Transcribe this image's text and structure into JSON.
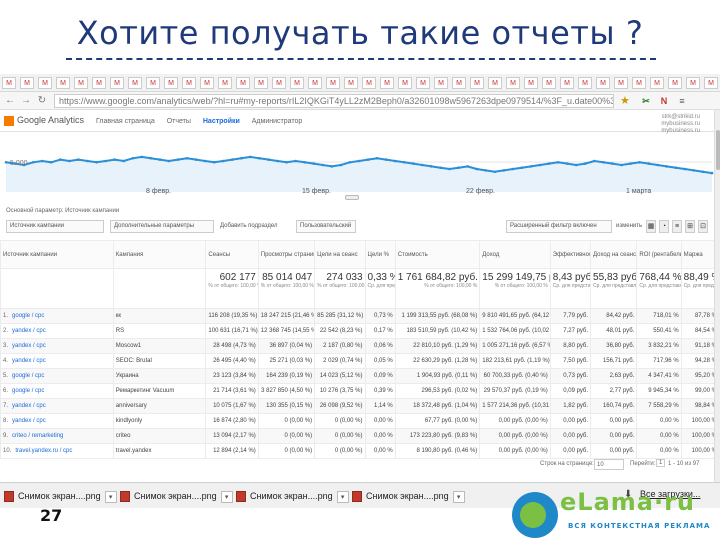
{
  "slide": {
    "title": "Хотите получать такие отчеты ?",
    "page_number": "27"
  },
  "browser": {
    "url": "https://www.google.com/analytics/web/?hl=ru#my-reports/rIL2IQKGiT4yLL2zM2Beph0/a32601098w5967263dpe0979514/%3F_u.date00%3D20130301%26_u.date01%3D20130331/",
    "tab_icons": [
      "M",
      "M",
      "M",
      "M",
      "M",
      "M",
      "M",
      "M",
      "M",
      "M",
      "M",
      "M",
      "M",
      "M",
      "M",
      "M",
      "M",
      "M",
      "M",
      "M",
      "M",
      "M",
      "M",
      "M",
      "M",
      "M",
      "M",
      "M",
      "M",
      "M",
      "M",
      "M",
      "M",
      "M",
      "M",
      "M",
      "M",
      "M",
      "M",
      "M",
      "M",
      "M",
      "M",
      "M",
      "M"
    ],
    "ext_icons": [
      "N",
      "✂",
      "≡"
    ]
  },
  "ga": {
    "logo_text": "Google Analytics",
    "nav": [
      "Главная страница",
      "Отчеты",
      "Настройки",
      "Администратор"
    ],
    "nav_active_index": 2,
    "user_line1": "strk@strikid.ru",
    "user_line2": "mybusiness.ru",
    "user_line3": "mybusiness.ru"
  },
  "chart_data": {
    "type": "line",
    "y_label_visible": "5 000",
    "x_ticks": [
      "8 февр.",
      "15 февр.",
      "22 февр.",
      "1 марта"
    ],
    "values": [
      62,
      61,
      60,
      62,
      63,
      62,
      64,
      63,
      64,
      63,
      62,
      63,
      64,
      63,
      65,
      66,
      65,
      64,
      63,
      64,
      65,
      64,
      63,
      62,
      63,
      64,
      65,
      66,
      65,
      64,
      63,
      62,
      63,
      62,
      61,
      60,
      59,
      60,
      62,
      63,
      64,
      65,
      64,
      63,
      62,
      61,
      60,
      59,
      58,
      57,
      58,
      59,
      57,
      56,
      55,
      56,
      57,
      58,
      59,
      60,
      61,
      62,
      61,
      60,
      61,
      63,
      62,
      61,
      60,
      61,
      62,
      61,
      60,
      59,
      58,
      57,
      56,
      55,
      54
    ]
  },
  "report": {
    "subheader": "Основной параметр: Источник кампании",
    "controls": {
      "select1": "Источник кампании",
      "select2": "Дополнительные параметры",
      "btn_add": "Добавить подраздел",
      "select3": "Пользовательский",
      "filter_placeholder": "Расширенный фильтр включен",
      "filter_btn": "изменить"
    },
    "view_icons": [
      "▦",
      "◔",
      "≡",
      "⊞",
      "⊡"
    ],
    "columns": [
      "Источник кампании",
      "Кампания",
      "Сеансы",
      "Просмотры страниц",
      "Цели на сеанс",
      "Цели %",
      "Стоимость",
      "Доход",
      "Эффективность",
      "Доход на сеанс",
      "ROI (рентабельность)",
      "Маржа"
    ],
    "totals": [
      {
        "big": "",
        "sub": ""
      },
      {
        "big": "",
        "sub": ""
      },
      {
        "big": "602 177",
        "sub": "% от общего: 100,00 % (602 177)"
      },
      {
        "big": "85 014 047",
        "sub": "% от общего: 100,00 % (85 014 047)"
      },
      {
        "big": "274 033",
        "sub": "% от общего: 100,00 % (274 033)"
      },
      {
        "big": "0,33 %",
        "sub": "Ср. для представления: 0,33 %"
      },
      {
        "big": "1 761 684,82 руб.",
        "sub": "% от общего: 100,00 %"
      },
      {
        "big": "15 299 149,75 руб.",
        "sub": "% от общего: 100,00 %"
      },
      {
        "big": "8,43 руб.",
        "sub": "Ср. для представления"
      },
      {
        "big": "55,83 руб.",
        "sub": "Ср. для представления"
      },
      {
        "big": "768,44 %",
        "sub": "Ср. для представления"
      },
      {
        "big": "88,49 %",
        "sub": "Ср. для представления"
      }
    ],
    "rows": [
      [
        "1.",
        "google / cpc",
        "кк",
        "116 208 (19,35 %)",
        "18 247 215 (21,46 %)",
        "85 285 (31,12 %)",
        "0,73 %",
        "1 199 313,55 руб. (68,08 %)",
        "9 810 491,65 руб. (64,12 %)",
        "7,79 руб.",
        "84,42 руб.",
        "718,01 %",
        "87,78 %"
      ],
      [
        "2.",
        "yandex / cpc",
        "RS",
        "100 631 (16,71 %)",
        "12 368 745 (14,55 %)",
        "22 542 (8,23 %)",
        "0,17 %",
        "183 510,59 руб. (10,42 %)",
        "1 532 764,06 руб. (10,02 %)",
        "7,27 руб.",
        "48,01 руб.",
        "550,41 %",
        "84,54 %"
      ],
      [
        "3.",
        "yandex / cpc",
        "Moscow1",
        "28 498 (4,73 %)",
        "36 897 (0,04 %)",
        "2 187 (0,80 %)",
        "0,06 %",
        "22 810,10 руб. (1,29 %)",
        "1 005 271,16 руб. (6,57 %)",
        "8,80 руб.",
        "36,80 руб.",
        "3 832,21 %",
        "91,18 %"
      ],
      [
        "4.",
        "yandex / cpc",
        "SEOC: Brutal",
        "26 495 (4,40 %)",
        "25 271 (0,03 %)",
        "2 029 (0,74 %)",
        "0,05 %",
        "22 630,29 руб. (1,28 %)",
        "182 213,61 руб. (1,19 %)",
        "7,50 руб.",
        "156,71 руб.",
        "717,96 %",
        "94,28 %"
      ],
      [
        "5.",
        "google / cpc",
        "Украина",
        "23 123 (3,84 %)",
        "164 239 (0,19 %)",
        "14 023 (5,12 %)",
        "0,09 %",
        "1 904,93 руб. (0,11 %)",
        "60 700,33 руб. (0,40 %)",
        "0,73 руб.",
        "2,63 руб.",
        "4 347,41 %",
        "95,20 %"
      ],
      [
        "6.",
        "google / cpc",
        "Ремаркетинг Vacuum",
        "21 714 (3,61 %)",
        "3 827 850 (4,50 %)",
        "10 276 (3,75 %)",
        "0,39 %",
        "296,53 руб. (0,02 %)",
        "29 570,37 руб. (0,19 %)",
        "0,09 руб.",
        "2,77 руб.",
        "9 945,34 %",
        "99,00 %"
      ],
      [
        "7.",
        "yandex / cpc",
        "anniversary",
        "10 075 (1,67 %)",
        "130 355 (0,15 %)",
        "26 098 (9,52 %)",
        "1,14 %",
        "18 372,48 руб. (1,04 %)",
        "1 577 214,36 руб. (10,31 %)",
        "1,82 руб.",
        "160,74 руб.",
        "7 558,29 %",
        "98,84 %"
      ],
      [
        "8.",
        "yandex / cpc",
        "kindlyonly",
        "16 874 (2,80 %)",
        "0 (0,00 %)",
        "0 (0,00 %)",
        "0,00 %",
        "67,77 руб. (0,00 %)",
        "0,00 руб. (0,00 %)",
        "0,00 руб.",
        "0,00 руб.",
        "0,00 %",
        "100,00 %"
      ],
      [
        "9.",
        "criteo / remarketing",
        "criteo",
        "13 094 (2,17 %)",
        "0 (0,00 %)",
        "0 (0,00 %)",
        "0,00 %",
        "173 223,80 руб. (9,83 %)",
        "0,00 руб. (0,00 %)",
        "0,00 руб.",
        "0,00 руб.",
        "0,00 %",
        "100,00 %"
      ],
      [
        "10.",
        "travel.yandex.ru / cpc",
        "travel.yandex",
        "12 894 (2,14 %)",
        "0 (0,00 %)",
        "0 (0,00 %)",
        "0,00 %",
        "8 190,80 руб. (0,46 %)",
        "0,00 руб. (0,00 %)",
        "0,00 руб.",
        "0,00 руб.",
        "0,00 %",
        "100,00 %"
      ]
    ],
    "pager": {
      "label": "Строк на странице:",
      "rows_value": "10",
      "goto_label": "Перейти:",
      "goto_value": "1",
      "range": "1 - 10 из 97"
    }
  },
  "taskbar": {
    "items": [
      "Снимок экран....png",
      "Снимок экран....png",
      "Снимок экран....png",
      "Снимок экран....png"
    ],
    "downloads_label": "Все загрузки..."
  },
  "logo": {
    "word": "eLama·ru",
    "tagline": "ВСЯ КОНТЕКСТНАЯ РЕКЛАМА"
  }
}
